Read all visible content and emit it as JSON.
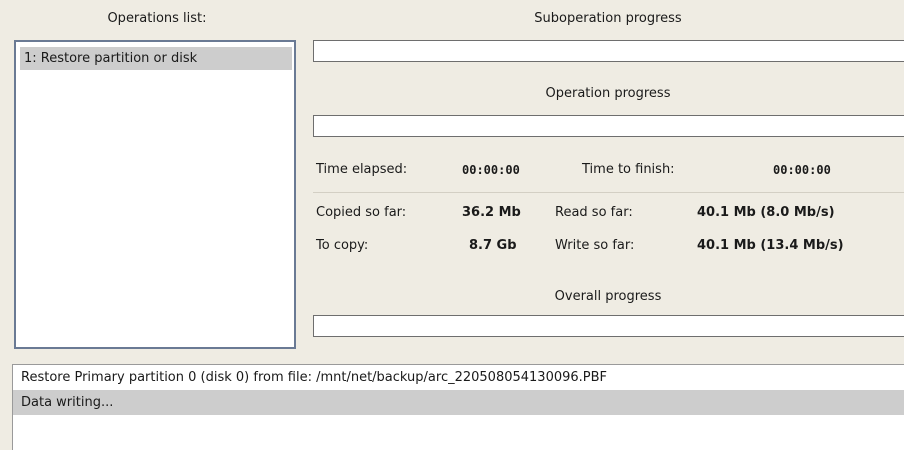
{
  "operations": {
    "title": "Operations list:",
    "items": [
      {
        "label": "1: Restore partition or disk"
      }
    ]
  },
  "suboperation": {
    "title": "Suboperation progress",
    "progress": 0
  },
  "operation": {
    "title": "Operation progress",
    "progress": 0
  },
  "overall": {
    "title": "Overall progress",
    "progress": 0
  },
  "stats": {
    "time_elapsed_label": "Time elapsed:",
    "time_elapsed_value": "00:00:00",
    "time_to_finish_label": "Time to finish:",
    "time_to_finish_value": "00:00:00",
    "copied_label": "Copied so far:",
    "copied_value": "36.2 Mb",
    "to_copy_label": "To copy:",
    "to_copy_value": "8.7 Gb",
    "read_label": "Read so far:",
    "read_value": "40.1 Mb (8.0 Mb/s)",
    "write_label": "Write so far:",
    "write_value": "40.1 Mb (13.4 Mb/s)"
  },
  "log": {
    "lines": [
      {
        "text": "Restore Primary partition 0 (disk 0) from file: /mnt/net/backup/arc_220508054130096.PBF"
      },
      {
        "text": "Data writing..."
      }
    ]
  },
  "colors": {
    "background": "#efece3",
    "selection": "#cdcdcd",
    "list_border": "#6a7a94"
  }
}
